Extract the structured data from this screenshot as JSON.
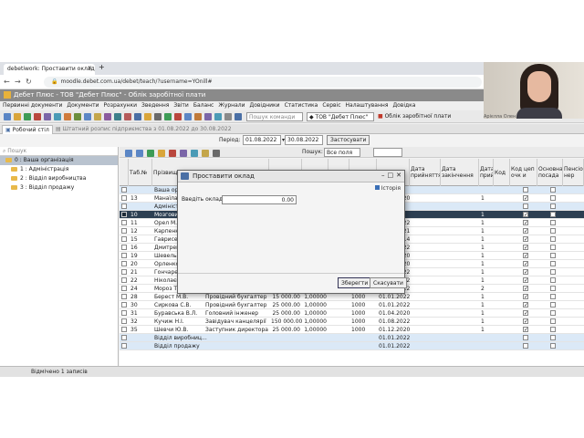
{
  "browser": {
    "tab_title": "debetiwork: Проставити оклад",
    "tab_close": "×",
    "new_tab": "+",
    "url": "moodle.debet.com.ua/debet/teach/?username=YOnill#"
  },
  "app": {
    "title": "Дебет Плюс - ТОВ \"Дебет Плюс\" - Облік заробітної плати",
    "menu": [
      "Первинні документи",
      "Документи",
      "Розрахунки",
      "Зведення",
      "Звіти",
      "Баланс",
      "Журнали",
      "Довідники",
      "Статистика",
      "Сервіс",
      "Налаштування",
      "Довідка"
    ],
    "command_placeholder": "Пошук команди",
    "organization": "ТОВ \"Дебет Плюс\"",
    "module": "Облік заробітної плати"
  },
  "doc_tabs": {
    "desk": "Робочий стіл",
    "staffing": "Штатний розпис підприємства з 01.08.2022 до 30.08.2022"
  },
  "period": {
    "label": "Період:",
    "from": "01.08.2022",
    "to": "30.08.2022",
    "apply": "Застосувати"
  },
  "sidebar": {
    "search_placeholder": "Пошук",
    "root": "0 : Ваша організація",
    "items": [
      "1 : Адміністрація",
      "2 : Відділ виробництва",
      "3 : Відділ продажу"
    ]
  },
  "grid_toolbar": {
    "search_label": "Пошук:",
    "field": "Все поля"
  },
  "grid": {
    "headers": [
      "Таб.№",
      "Прізвище",
      "Посада",
      "Оклад",
      "Ставка",
      "Грн/год",
      "Код",
      "Дата прийняття",
      "Дата закінчення",
      "Дата прийняття",
      "Код",
      "Код цеп очк и",
      "Основна посада",
      "Пенсіо нер"
    ],
    "rows": [
      {
        "type": "group",
        "name": "Ваша орг..."
      },
      {
        "tab": "13",
        "name": "Манаїла ...",
        "pos": "",
        "sal": "",
        "rate": "",
        "hr": "",
        "code": "",
        "date": "01.12.2020",
        "k": "1",
        "main": true,
        "pens": false
      },
      {
        "type": "group",
        "name": "Адміністр..."
      },
      {
        "type": "selected",
        "tab": "10",
        "name": "Мозговий ...",
        "pos": "",
        "sal": "",
        "rate": "",
        "hr": "",
        "code": "",
        "date": "",
        "k": "1",
        "main": true,
        "pens": false
      },
      {
        "tab": "11",
        "name": "Орел М.В.",
        "pos": "",
        "sal": "",
        "rate": "",
        "hr": "",
        "code": "",
        "date": "01.08.2022",
        "k": "1",
        "main": true,
        "pens": false
      },
      {
        "tab": "12",
        "name": "Карпенко ...",
        "pos": "",
        "sal": "",
        "rate": "",
        "hr": "",
        "code": "",
        "date": "15.12.2021",
        "k": "1",
        "main": true,
        "pens": false
      },
      {
        "tab": "15",
        "name": "Гаврисен...",
        "pos": "",
        "sal": "",
        "rate": "",
        "hr": "",
        "code": "",
        "date": "01.08.2014",
        "k": "1",
        "main": true,
        "pens": false
      },
      {
        "tab": "16",
        "name": "Дмитрен...",
        "pos": "",
        "sal": "",
        "rate": "",
        "hr": "",
        "code": "",
        "date": "01.02.2022",
        "k": "1",
        "main": true,
        "pens": false
      },
      {
        "tab": "19",
        "name": "Шевельо...",
        "pos": "",
        "sal": "",
        "rate": "",
        "hr": "",
        "code": "",
        "date": "01.12.2020",
        "k": "1",
        "main": true,
        "pens": false
      },
      {
        "tab": "20",
        "name": "Орленко ...",
        "pos": "",
        "sal": "",
        "rate": "",
        "hr": "",
        "code": "",
        "date": "01.12.2020",
        "k": "1",
        "main": true,
        "pens": false
      },
      {
        "tab": "21",
        "name": "Гончарен...",
        "pos": "",
        "sal": "",
        "rate": "",
        "hr": "",
        "code": "",
        "date": "01.01.2022",
        "k": "1",
        "main": true,
        "pens": false
      },
      {
        "tab": "22",
        "name": "Ніколаєн...",
        "pos": "",
        "sal": "",
        "rate": "",
        "hr": "",
        "code": "",
        "date": "01.01.2022",
        "k": "1",
        "main": true,
        "pens": false
      },
      {
        "tab": "24",
        "name": "Мороз Т.С.",
        "pos": "",
        "sal": "",
        "rate": "",
        "hr": "",
        "code": "",
        "date": "01.11.2022",
        "k": "2",
        "main": true,
        "pens": false
      },
      {
        "tab": "28",
        "name": "Берест М.В.",
        "pos": "Провідний бухгалтер",
        "sal": "15 000.00",
        "rate": "1,00000",
        "hr": "",
        "code": "1000",
        "date": "01.01.2022",
        "k": "1",
        "main": true,
        "pens": false
      },
      {
        "tab": "30",
        "name": "Сиркова С.В.",
        "pos": "Провідний бухгалтер",
        "sal": "25 000.00",
        "rate": "1,00000",
        "hr": "",
        "code": "1000",
        "date": "01.01.2022",
        "k": "1",
        "main": true,
        "pens": false
      },
      {
        "tab": "31",
        "name": "Буравська В.Л.",
        "pos": "Головний інженер",
        "sal": "25 000.00",
        "rate": "1,00000",
        "hr": "",
        "code": "1000",
        "date": "01.04.2020",
        "k": "1",
        "main": true,
        "pens": false
      },
      {
        "tab": "32",
        "name": "Кучиж Н.І.",
        "pos": "Завідувач канцелярії",
        "sal": "150 000.00",
        "rate": "1,00000",
        "hr": "",
        "code": "1000",
        "date": "01.08.2022",
        "k": "1",
        "main": true,
        "pens": false
      },
      {
        "tab": "35",
        "name": "Шевчи Ю.В.",
        "pos": "Заступник директора",
        "sal": "25 000.00",
        "rate": "1,00000",
        "hr": "",
        "code": "1000",
        "date": "01.12.2020",
        "k": "1",
        "main": true,
        "pens": false
      },
      {
        "type": "group",
        "name": "Відділ виробниц...",
        "date": "01.01.2022"
      },
      {
        "type": "group",
        "name": "Відділ продажу",
        "date": "01.01.2022"
      }
    ]
  },
  "status": "Відмічено 1 записів",
  "dialog": {
    "title": "Проставити оклад",
    "history": "Історія",
    "salary_label": "Введіть оклад:",
    "salary_value": "0.00",
    "save": "Зберегти",
    "cancel": "Скасувати"
  },
  "webcam": {
    "name": "Арієлла Олен..."
  }
}
